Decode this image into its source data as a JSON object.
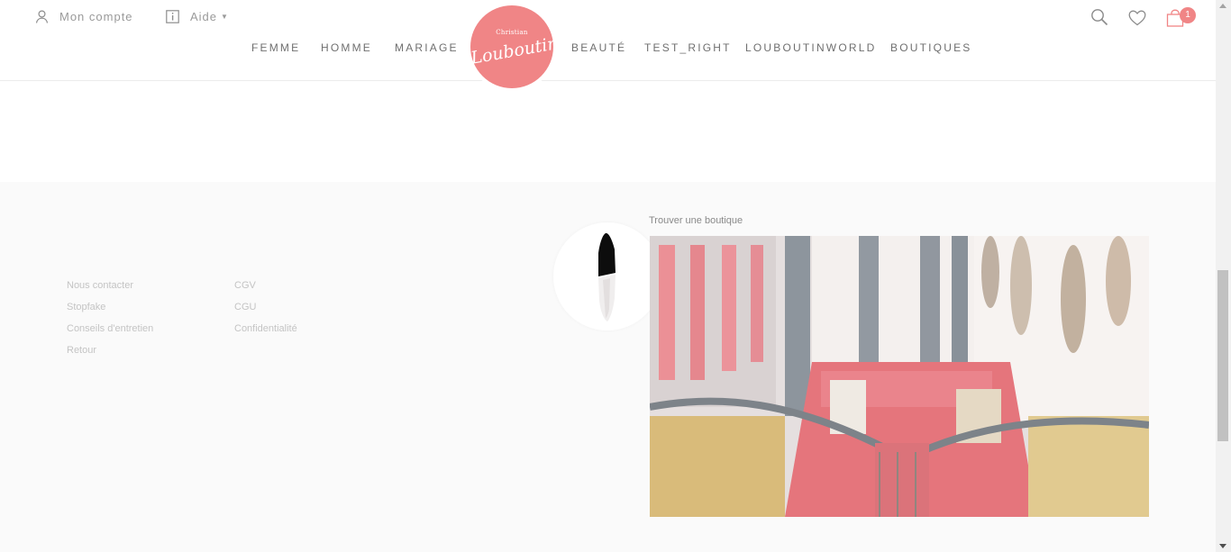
{
  "header": {
    "account_label": "Mon compte",
    "help_label": "Aide",
    "nav": [
      "FEMME",
      "HOMME",
      "MARIAGE",
      "BEAUTÉ",
      "TEST_RIGHT",
      "LOUBOUTINWORLD",
      "BOUTIQUES"
    ],
    "logo": {
      "line1": "Christian",
      "line2": "Louboutin"
    },
    "cart_count": "1",
    "accent_color": "#f08586"
  },
  "footer": {
    "links_col1": [
      "Nous contacter",
      "Stopfake",
      "Conseils d'entretien",
      "Retour"
    ],
    "links_col2": [
      "CGV",
      "CGU",
      "Confidentialité"
    ],
    "boutique_title": "Trouver une boutique"
  }
}
